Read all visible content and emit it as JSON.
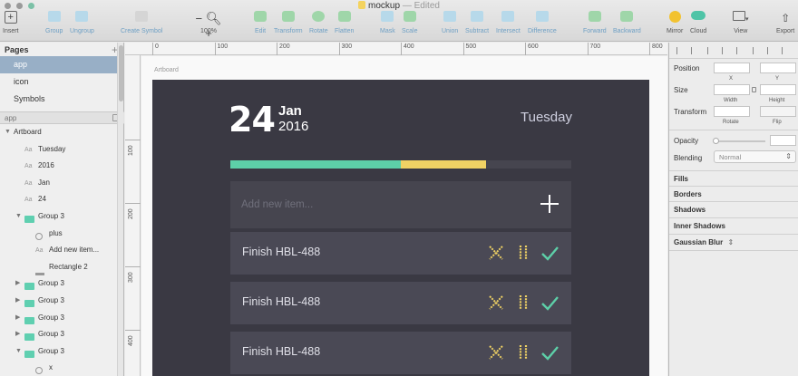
{
  "window": {
    "doc_name": "mockup",
    "doc_status": "— Edited"
  },
  "toolbar": {
    "insert": "Insert",
    "group": "Group",
    "ungroup": "Ungroup",
    "create_symbol": "Create Symbol",
    "zoom_minus": "−",
    "zoom_plus": "+",
    "zoom_level": "100%",
    "edit": "Edit",
    "transform": "Transform",
    "rotate": "Rotate",
    "flatten": "Flatten",
    "mask": "Mask",
    "scale": "Scale",
    "union": "Union",
    "subtract": "Subtract",
    "intersect": "Intersect",
    "difference": "Difference",
    "forward": "Forward",
    "backward": "Backward",
    "mirror": "Mirror",
    "cloud": "Cloud",
    "view": "View",
    "export": "Export"
  },
  "pages": {
    "title": "Pages",
    "add": "+",
    "items": [
      "app",
      "icon",
      "Symbols"
    ]
  },
  "layers": {
    "page_label": "app",
    "items": [
      {
        "label": "Artboard",
        "indent": 0,
        "twisty": "▼",
        "icon": "none"
      },
      {
        "label": "Tuesday",
        "indent": 1,
        "twisty": "",
        "icon": "text"
      },
      {
        "label": "2016",
        "indent": 1,
        "twisty": "",
        "icon": "text"
      },
      {
        "label": "Jan",
        "indent": 1,
        "twisty": "",
        "icon": "text"
      },
      {
        "label": "24",
        "indent": 1,
        "twisty": "",
        "icon": "text"
      },
      {
        "label": "Group 3",
        "indent": 1,
        "twisty": "▼",
        "icon": "folder"
      },
      {
        "label": "plus",
        "indent": 2,
        "twisty": "",
        "icon": "symbol"
      },
      {
        "label": "Add new item...",
        "indent": 2,
        "twisty": "",
        "icon": "text"
      },
      {
        "label": "Rectangle 2",
        "indent": 2,
        "twisty": "",
        "icon": "rect"
      },
      {
        "label": "Group 3",
        "indent": 1,
        "twisty": "▶",
        "icon": "folder"
      },
      {
        "label": "Group 3",
        "indent": 1,
        "twisty": "▶",
        "icon": "folder"
      },
      {
        "label": "Group 3",
        "indent": 1,
        "twisty": "▶",
        "icon": "folder"
      },
      {
        "label": "Group 3",
        "indent": 1,
        "twisty": "▶",
        "icon": "folder"
      },
      {
        "label": "Group 3",
        "indent": 1,
        "twisty": "▼",
        "icon": "folder"
      },
      {
        "label": "x",
        "indent": 2,
        "twisty": "",
        "icon": "symbol"
      }
    ],
    "text_icon": "Aa"
  },
  "rulers": {
    "top": [
      "0",
      "100",
      "200",
      "300",
      "400",
      "500",
      "600",
      "700",
      "800"
    ],
    "left": [
      "100",
      "200",
      "300",
      "400"
    ]
  },
  "canvas": {
    "artboard_label": "Artboard"
  },
  "mockup": {
    "day": "24",
    "month": "Jan",
    "year": "2016",
    "weekday": "Tuesday",
    "progress": {
      "completed": 0.5,
      "in_progress": 0.25
    },
    "new_item_placeholder": "Add new item...",
    "tasks": [
      "Finish HBL-488",
      "Finish HBL-488",
      "Finish HBL-488"
    ],
    "colors": {
      "background": "#3a3943",
      "card": "#4a4955",
      "completed": "#5dcfa8",
      "in_progress": "#f0d264",
      "delete_icon": "#f0d264",
      "pause_icon": "#f0d264",
      "check_icon": "#5dcfa8"
    }
  },
  "inspector": {
    "position": "Position",
    "x_label": "X",
    "y_label": "Y",
    "size": "Size",
    "width_label": "Width",
    "height_label": "Height",
    "transform": "Transform",
    "rotate_label": "Rotate",
    "flip_label": "Flip",
    "opacity": "Opacity",
    "blending": "Blending",
    "blending_value": "Normal",
    "sections": [
      "Fills",
      "Borders",
      "Shadows",
      "Inner Shadows",
      "Gaussian Blur"
    ]
  }
}
